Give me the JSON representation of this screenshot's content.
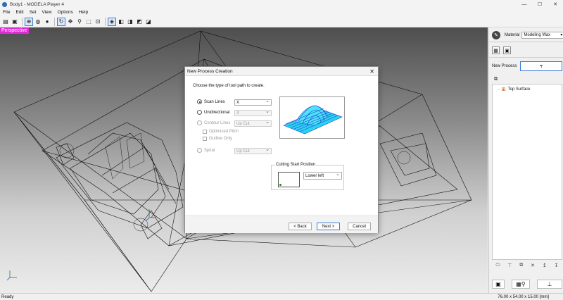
{
  "window": {
    "title": "Body1 - MODELA Player 4",
    "minimize": "—",
    "maximize": "☐",
    "close": "✕"
  },
  "menu": [
    "File",
    "Edit",
    "Set",
    "View",
    "Options",
    "Help"
  ],
  "viewport": {
    "mode_label": "Perspective"
  },
  "right_panel": {
    "material_label": "Material",
    "material_value": "Modeling Wax",
    "new_process_label": "New Process",
    "tree_items": [
      "Top Surface"
    ]
  },
  "status": {
    "left": "Ready",
    "dimensions": "76.00 x 54.00 x 15.00 [mm]"
  },
  "dialog": {
    "title": "New Process Creation",
    "instruction": "Choose the type of tool path to create.",
    "options": {
      "scan_lines": {
        "label": "Scan Lines",
        "value": "X"
      },
      "unidirectional": {
        "label": "Unidirectional",
        "value": "X"
      },
      "contour_lines": {
        "label": "Contour Lines",
        "value": "Up Cut"
      },
      "optimized_pitch": "Optimized Pitch",
      "outline_only": "Outline Only",
      "spiral": {
        "label": "Spiral",
        "value": "Up Cut"
      }
    },
    "cutting_start": {
      "label": "Cutting Start Position",
      "value": "Lower left"
    },
    "buttons": {
      "back": "< Back",
      "next": "Next >",
      "cancel": "Cancel"
    }
  },
  "colors": {
    "perspective_badge": "#e02ad8",
    "accent": "#3b7bd1",
    "preview_cyan": "#2ad4f0",
    "preview_blue": "#1a3fd0"
  }
}
